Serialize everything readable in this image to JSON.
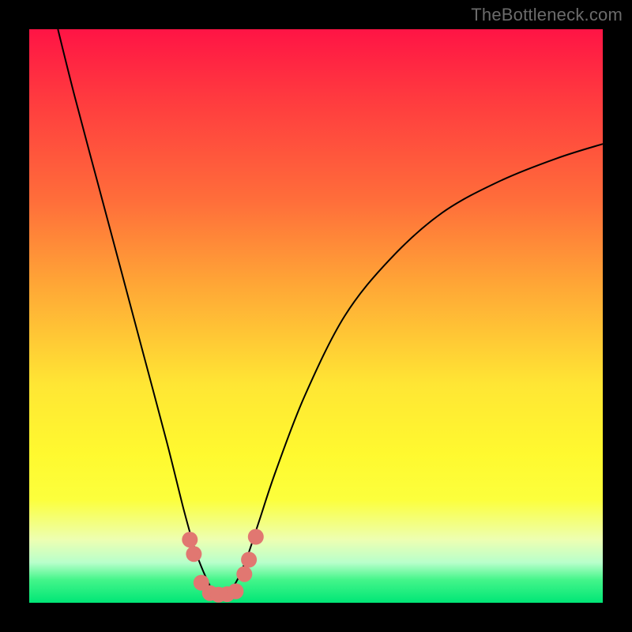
{
  "watermark": "TheBottleneck.com",
  "colors": {
    "background": "#000000",
    "gradient_top": "#ff1445",
    "gradient_bottom": "#00e676",
    "curve": "#000000",
    "marker": "#e17771"
  },
  "chart_data": {
    "type": "line",
    "title": "",
    "xlabel": "",
    "ylabel": "",
    "xlim": [
      0,
      100
    ],
    "ylim": [
      0,
      100
    ],
    "series": [
      {
        "name": "bottleneck-curve",
        "x": [
          5,
          8,
          12,
          16,
          20,
          24,
          27,
          29,
          31,
          32.5,
          34,
          36,
          38,
          40,
          43,
          48,
          55,
          63,
          72,
          82,
          92,
          100
        ],
        "y": [
          100,
          88,
          73,
          58,
          43,
          28,
          16,
          9,
          4,
          1.5,
          1.5,
          3.5,
          8,
          14,
          23,
          36,
          50,
          60,
          68,
          73.5,
          77.5,
          80
        ]
      }
    ],
    "markers": {
      "name": "highlight-points",
      "points": [
        {
          "x": 28.0,
          "y": 11.0
        },
        {
          "x": 28.7,
          "y": 8.5
        },
        {
          "x": 30.0,
          "y": 3.5
        },
        {
          "x": 31.5,
          "y": 1.7
        },
        {
          "x": 33.0,
          "y": 1.4
        },
        {
          "x": 34.5,
          "y": 1.5
        },
        {
          "x": 36.0,
          "y": 2.0
        },
        {
          "x": 37.5,
          "y": 5.0
        },
        {
          "x": 38.3,
          "y": 7.5
        },
        {
          "x": 39.5,
          "y": 11.5
        }
      ]
    }
  }
}
